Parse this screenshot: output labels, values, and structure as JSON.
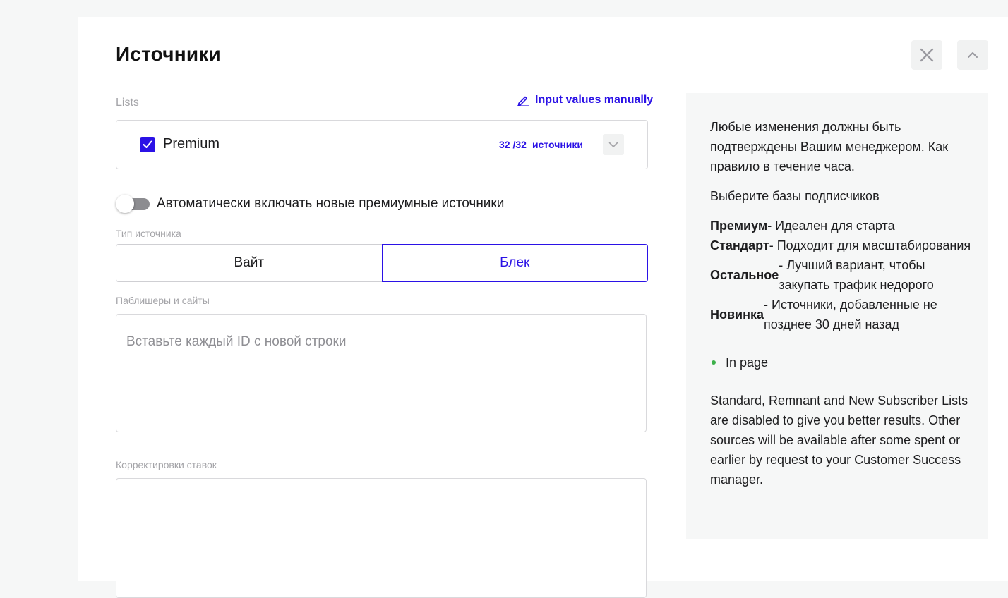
{
  "title": "Источники",
  "lists": {
    "label": "Lists",
    "manual_link": "Input values manually",
    "item": {
      "name": "Premium",
      "checked": true,
      "count": "32 /32",
      "count_unit": "источники"
    }
  },
  "auto_toggle": {
    "label": "Автоматически включать новые премиумные источники",
    "on": false
  },
  "source_type": {
    "label": "Тип источника",
    "options": [
      "Вайт",
      "Блек"
    ],
    "selected": "Блек"
  },
  "publishers": {
    "label": "Паблишеры и сайты",
    "placeholder": "Вставьте каждый ID с новой строки"
  },
  "bids": {
    "label": "Корректировки ставок"
  },
  "info": {
    "intro": "Любые изменения должны быть подтверждены Вашим менеджером. Как правило в течение часа.",
    "choose": "Выберите базы подписчиков",
    "tiers": [
      {
        "name": "Премиум",
        "desc": " - Идеален для старта"
      },
      {
        "name": "Стандарт",
        "desc": " - Подходит для масштабирования"
      },
      {
        "name": "Остальное",
        "desc": " - Лучший вариант, чтобы закупать трафик недорого"
      },
      {
        "name": "Новинка",
        "desc": "- Источники, добавленные не позднее 30 дней назад"
      }
    ],
    "bullet": "In page",
    "note": "Standard, Remnant and New Subscriber Lists are disabled to give you better results. Other sources will be available after some spent or earlier by request to your Customer Success manager."
  },
  "colors": {
    "accent": "#2b12e6",
    "bullet": "#3cb04a",
    "panel_bg": "#f6f7f7"
  }
}
